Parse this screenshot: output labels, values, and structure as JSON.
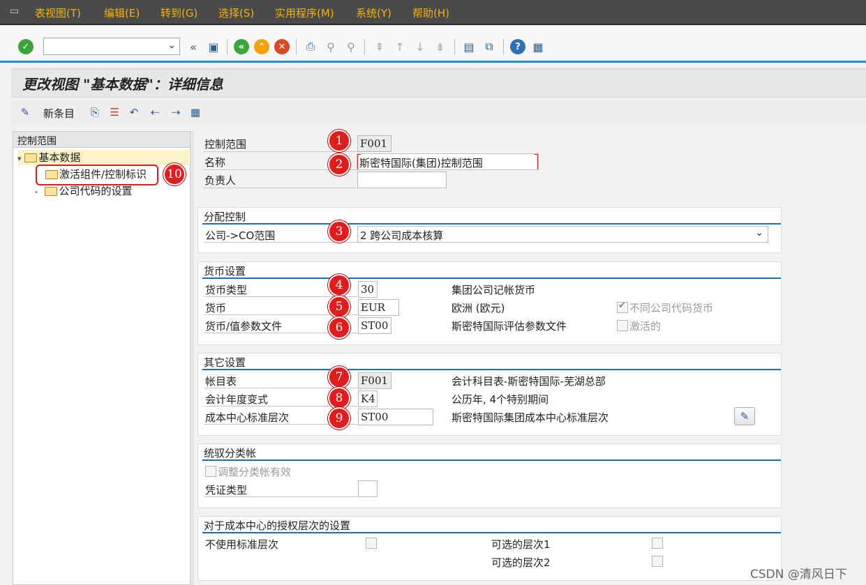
{
  "menu": {
    "items": [
      "表视图(T)",
      "编辑(E)",
      "转到(G)",
      "选择(S)",
      "实用程序(M)",
      "系统(Y)",
      "帮助(H)"
    ]
  },
  "toolbar": {
    "command_value": "",
    "icons": [
      "enter-check",
      "save",
      "back",
      "exit",
      "cancel",
      "print",
      "find",
      "find-next",
      "first-page",
      "prev-page",
      "next-page",
      "last-page",
      "new-session",
      "shortcut",
      "help",
      "customize-layout"
    ]
  },
  "title": "更改视图 \"基本数据\"：详细信息",
  "app_toolbar": {
    "new_entries": "新条目"
  },
  "tree": {
    "header": "控制范围",
    "root": "基本数据",
    "children": [
      "激活组件/控制标识",
      "公司代码的设置"
    ]
  },
  "main": {
    "controlling_area": {
      "label": "控制范围",
      "value": "F001"
    },
    "name": {
      "label": "名称",
      "value": "斯密特国际(集团)控制范围"
    },
    "person_responsible": {
      "label": "负责人",
      "value": ""
    },
    "assignment": {
      "title": "分配控制",
      "company_co_label": "公司->CO范围",
      "company_co_value": "2 跨公司成本核算"
    },
    "currency": {
      "title": "货币设置",
      "type_label": "货币类型",
      "type_value": "30",
      "type_desc": "集团公司记帐货币",
      "currency_label": "货币",
      "currency_value": "EUR",
      "currency_desc": "欧洲 (欧元)",
      "diff_cc_currency": "不同公司代码货币",
      "profile_label": "货币/值参数文件",
      "profile_value": "ST00",
      "profile_desc": "斯密特国际评估参数文件",
      "active": "激活的"
    },
    "other": {
      "title": "其它设置",
      "coa_label": "帐目表",
      "coa_value": "F001",
      "coa_desc": "会计科目表-斯密特国际-芜湖总部",
      "fyv_label": "会计年度变式",
      "fyv_value": "K4",
      "fyv_desc": "公历年, 4个特别期间",
      "cch_label": "成本中心标准层次",
      "cch_value": "ST00",
      "cch_desc": "斯密特国际集团成本中心标准层次"
    },
    "recon": {
      "title": "统驭分类帐",
      "adjust": "调整分类帐有效",
      "doc_type_label": "凭证类型",
      "doc_type_value": ""
    },
    "auth": {
      "title": "对于成本中心的授权层次的设置",
      "no_std": "不使用标准层次",
      "alt1": "可选的层次1",
      "alt2": "可选的层次2"
    }
  },
  "callouts": [
    "1",
    "2",
    "3",
    "4",
    "5",
    "6",
    "7",
    "8",
    "9",
    "10"
  ],
  "watermark": "CSDN @清风日下",
  "colors": {
    "accent": "#1b8fd6",
    "menu_text": "#f4b400",
    "callout": "#e31b1b"
  }
}
